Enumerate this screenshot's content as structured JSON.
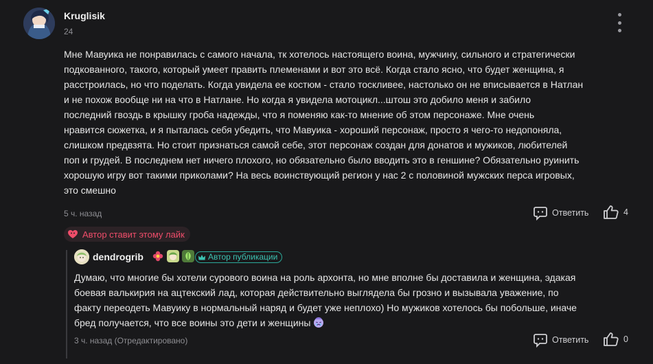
{
  "comment": {
    "author": "Kruglisik",
    "level": "24",
    "lines": [
      "Мне Мавуика не понравилась с самого начала, тк хотелось настоящего воина, мужчину, сильного и стратегически",
      "подкованного, такого, который умеет править племенами и вот это всё. Когда стало ясно, что будет женщина, я",
      "расстроилась, но что поделать. Когда увидела ее костюм - стало тоскливее, настолько он не вписывается в Натлан",
      "и не похож вообще ни на что в Натлане. Но когда я увидела мотоцикл...штош это добило меня и забило",
      "последний гвоздь в крышку гроба надежды, что я поменяю как-то мнение об этом персонаже. Мне очень",
      "нравится сюжетка, и я пыталась себя убедить, что Мавуика - хороший персонаж, просто я чего-то недопоняла,",
      "слишком предвзята. Но стоит признаться самой себе, этот персонаж создан для донатов и мужиков, любителей",
      "поп и грудей. В последнем нет ничего плохого, но обязательно было вводить это в геншине? Обязательно руинить",
      "хорошую игру вот такими приколами? На весь воинствующий регион у нас 2 с половиной мужских перса игровых,",
      "это смешно"
    ],
    "time": "5 ч. назад",
    "reply_label": "Ответить",
    "likes": "4",
    "author_liked": "Автор ставит этому лайк"
  },
  "reply": {
    "author": "dendrogrib",
    "author_tag": "Автор публикации",
    "lines": [
      "Думаю, что многие бы хотели сурового воина на роль архонта, но мне вполне бы доставила и женщина, эдакая",
      "боевая валькирия на ацтекский лад, которая действительно выглядела бы грозно и вызывала уважение, по",
      "факту переодеть Мавуику в нормальный наряд и будет уже неплохо) Но мужиков хотелось бы побольше, иначе",
      "бред получается, что все воины это дети и женщины"
    ],
    "time": "3 ч. назад (Отредактировано)",
    "reply_label": "Ответить",
    "likes": "0"
  },
  "icons": {
    "more": "more-vertical-icon",
    "reply": "speech-bubble-icon",
    "like": "thumbs-up-icon",
    "heart": "heart-icon",
    "author": "crown-icon",
    "emoji": "crying-emoji-icon"
  },
  "colors": {
    "background": "#19191b",
    "accent_like": "#ef4d6a",
    "accent_author": "#3cc2b1"
  }
}
